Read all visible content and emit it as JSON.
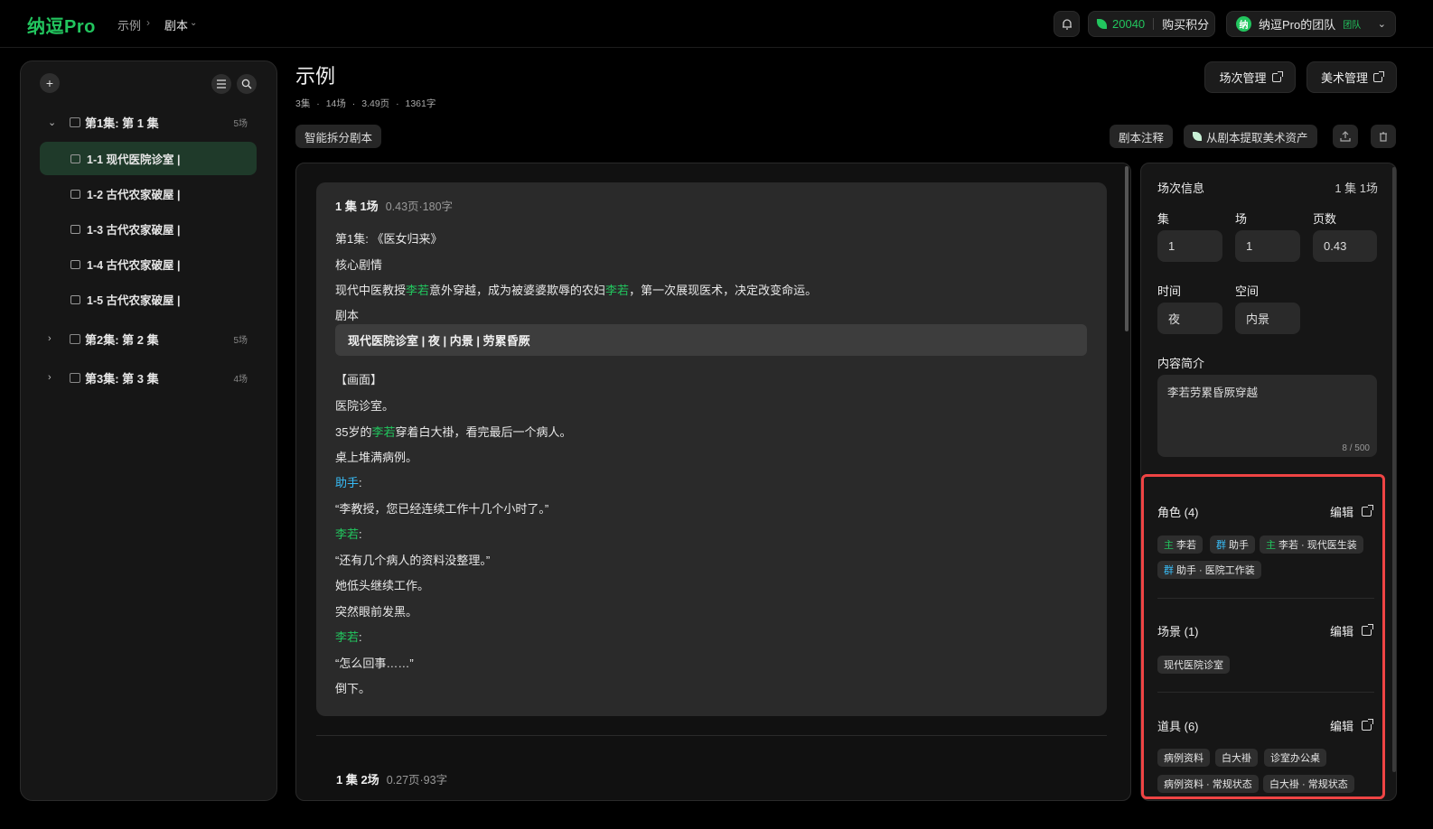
{
  "header": {
    "logo": "纳逗Pro",
    "breadcrumb": [
      "示例",
      "剧本"
    ],
    "credits": "20040",
    "buy_label": "购买积分",
    "team_avatar": "纳",
    "team_name": "纳逗Pro的团队",
    "team_badge": "团队"
  },
  "sidebar": {
    "episodes": [
      {
        "label": "第1集: 第 1 集",
        "count": "5场",
        "expanded": true
      },
      {
        "label": "第2集: 第 2 集",
        "count": "5场",
        "expanded": false
      },
      {
        "label": "第3集: 第 3 集",
        "count": "4场",
        "expanded": false
      }
    ],
    "scenes": [
      {
        "label": "1-1 现代医院诊室 |",
        "active": true
      },
      {
        "label": "1-2 古代农家破屋 |"
      },
      {
        "label": "1-3 古代农家破屋 |"
      },
      {
        "label": "1-4 古代农家破屋 |"
      },
      {
        "label": "1-5 古代农家破屋 |"
      }
    ]
  },
  "main": {
    "title": "示例",
    "meta": [
      "3集",
      "·",
      "14场",
      "·",
      "3.49页",
      "·",
      "1361字"
    ],
    "scene_mgmt": "场次管理",
    "art_mgmt": "美术管理",
    "split_btn": "智能拆分剧本",
    "annotate_btn": "剧本注释",
    "extract_btn": "从剧本提取美术资产"
  },
  "script": {
    "scene1_head": "1 集 1场",
    "scene1_meta": "0.43页·180字",
    "ep_title": "第1集: 《医女归来》",
    "core_label": "核心剧情",
    "core_pre": "现代中医教授",
    "core_name1": "李若",
    "core_mid": "意外穿越，成为被婆婆欺辱的农妇",
    "core_name2": "李若",
    "core_post": "，第一次展现医术，决定改变命运。",
    "script_label": "剧本",
    "heading": "现代医院诊室 | 夜 | 内景 | 劳累昏厥",
    "frame_label": "【画面】",
    "l1": "医院诊室。",
    "l2_pre": "35岁的",
    "l2_name": "李若",
    "l2_post": "穿着白大褂，看完最后一个病人。",
    "l3": "桌上堆满病例。",
    "assistant": "助手",
    "colon": ":",
    "l4": "“李教授，您已经连续工作十几个小时了。”",
    "lr1": "李若",
    "l5": "“还有几个病人的资料没整理。”",
    "l6": "她低头继续工作。",
    "l7": "突然眼前发黑。",
    "lr2": "李若",
    "l8": "“怎么回事……”",
    "l9": "倒下。",
    "scene2_head": "1 集 2场",
    "scene2_meta": "0.27页·93字"
  },
  "panel": {
    "title": "场次信息",
    "summary": "1 集 1场",
    "ep_label": "集",
    "ep_val": "1",
    "scene_label": "场",
    "scene_val": "1",
    "pages_label": "页数",
    "pages_val": "0.43",
    "time_label": "时间",
    "time_val": "夜",
    "space_label": "空间",
    "space_val": "内景",
    "desc_label": "内容简介",
    "desc_val": "李若劳累昏厥穿越",
    "desc_count": "8 / 500",
    "edit_label": "编辑",
    "roles_title": "角色 (4)",
    "roles": [
      {
        "kind": "主",
        "name": "李若"
      },
      {
        "kind": "群",
        "name": "助手"
      },
      {
        "kind": "主",
        "name": "李若 · 现代医生装"
      },
      {
        "kind": "群",
        "name": "助手 · 医院工作装"
      }
    ],
    "scenes_title": "场景 (1)",
    "scenes": [
      "现代医院诊室"
    ],
    "props_title": "道具 (6)",
    "props": [
      "病例资料",
      "白大褂",
      "诊室办公桌",
      "病例资料 · 常规状态",
      "白大褂 · 常规状态"
    ]
  }
}
